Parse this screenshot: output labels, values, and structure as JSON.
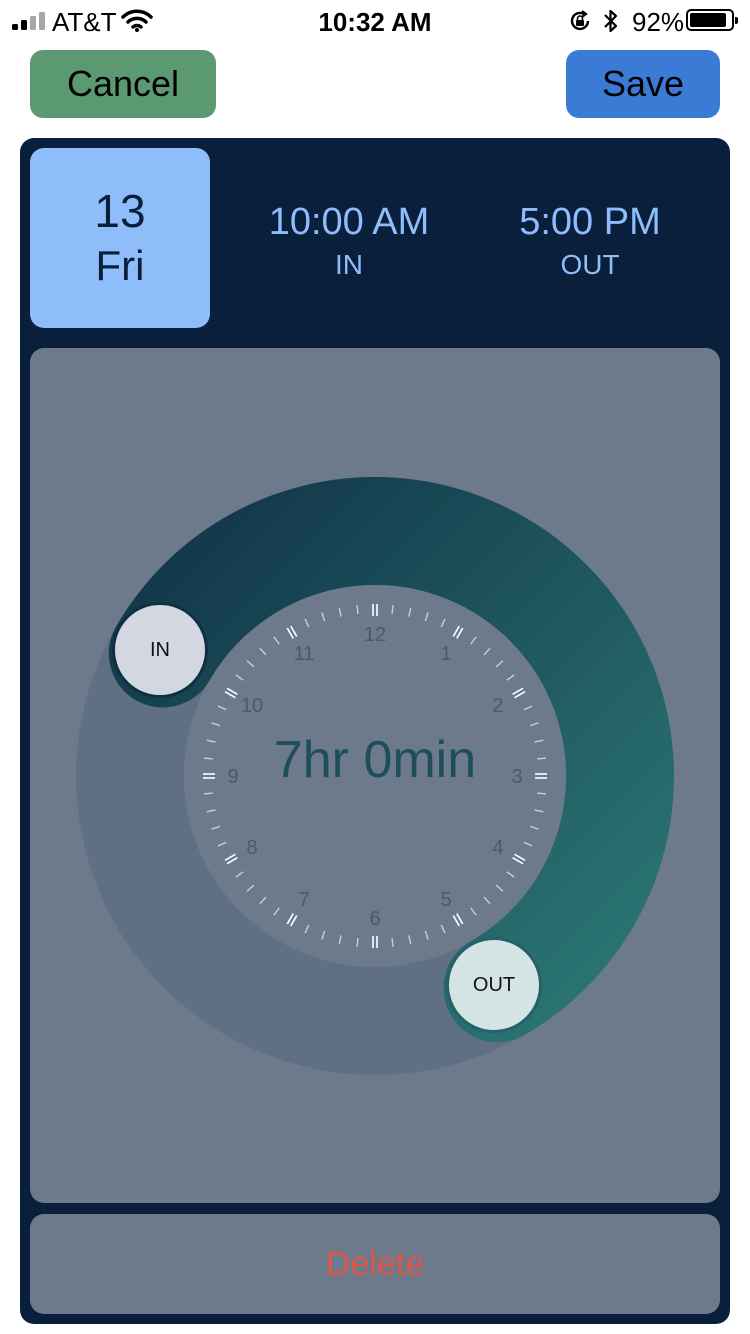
{
  "status_bar": {
    "carrier": "AT&T",
    "time": "10:32 AM",
    "battery_percent": "92%",
    "battery_level": 0.92,
    "icons": [
      "signal-icon",
      "wifi-icon",
      "orientation-lock-icon",
      "bluetooth-icon",
      "battery-icon"
    ]
  },
  "toolbar": {
    "cancel_label": "Cancel",
    "save_label": "Save"
  },
  "entry": {
    "date_number": "13",
    "date_day": "Fri",
    "in_time": "10:00 AM",
    "in_label": "IN",
    "out_time": "5:00 PM",
    "out_label": "OUT"
  },
  "dial": {
    "hour_numbers": [
      "12",
      "1",
      "2",
      "3",
      "4",
      "5",
      "6",
      "7",
      "8",
      "9",
      "10",
      "11"
    ],
    "duration": "7hr 0min",
    "in_knob_label": "IN",
    "out_knob_label": "OUT",
    "in_hour": 10,
    "out_hour": 17
  },
  "actions": {
    "delete_label": "Delete"
  },
  "colors": {
    "panel": "#0a1f3c",
    "date_card": "#8ebdfa",
    "cancel": "#5b9a71",
    "save": "#3a7bd6",
    "arc_start": "#0f2f45",
    "arc_end": "#2e7d78",
    "delete_text": "#e0544a"
  }
}
